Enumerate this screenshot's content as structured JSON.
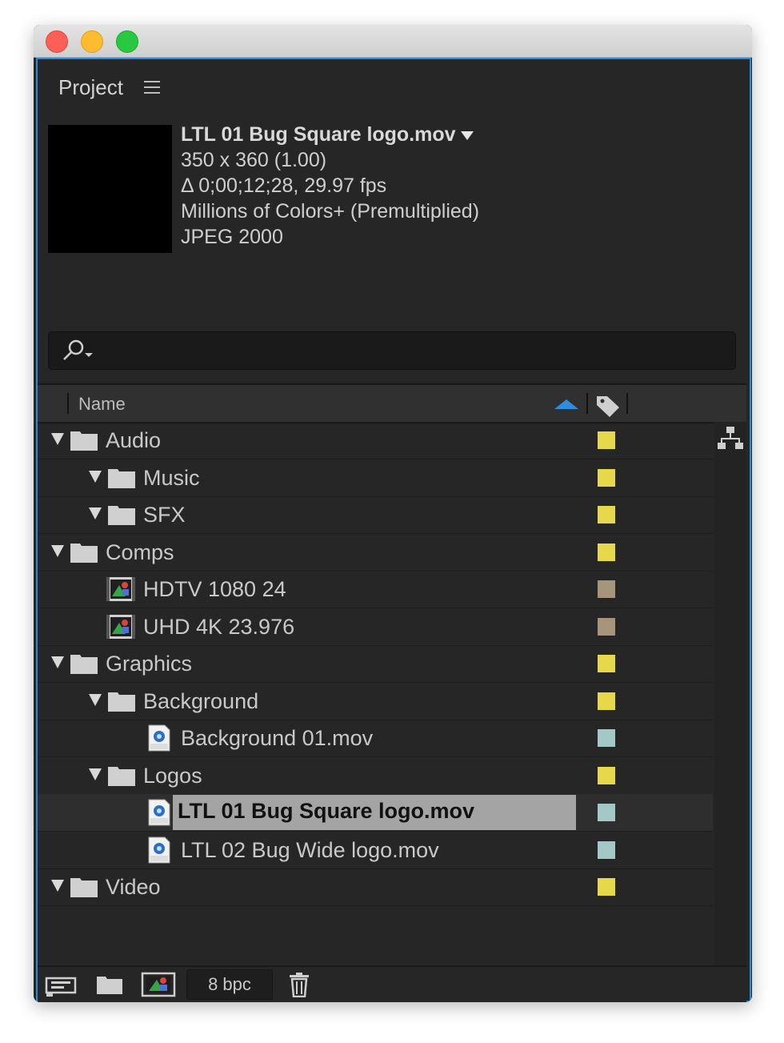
{
  "panel": {
    "title": "Project"
  },
  "preview": {
    "filename": "LTL 01 Bug Square logo.mov",
    "dimensions": "350 x 360 (1.00)",
    "duration": "Δ 0;00;12;28, 29.97 fps",
    "colors": "Millions of Colors+ (Premultiplied)",
    "codec": "JPEG 2000"
  },
  "search": {
    "value": "",
    "placeholder": ""
  },
  "columns": {
    "name": "Name"
  },
  "colors": {
    "folder_label": "#e6d84a",
    "comp_label": "#a6957a",
    "footage_label": "#a4c8c6",
    "accent": "#2b8cde",
    "selection": "#a4a4a4"
  },
  "rows": [
    {
      "label": "Audio",
      "type": "folder",
      "depth": 0,
      "expanded": true,
      "color": "#e6d84a"
    },
    {
      "label": "Music",
      "type": "folder",
      "depth": 1,
      "expanded": true,
      "color": "#e6d84a"
    },
    {
      "label": "SFX",
      "type": "folder",
      "depth": 1,
      "expanded": true,
      "color": "#e6d84a"
    },
    {
      "label": "Comps",
      "type": "folder",
      "depth": 0,
      "expanded": true,
      "color": "#e6d84a"
    },
    {
      "label": "HDTV 1080 24",
      "type": "comp",
      "depth": 1,
      "color": "#a6957a"
    },
    {
      "label": "UHD 4K 23.976",
      "type": "comp",
      "depth": 1,
      "color": "#a6957a"
    },
    {
      "label": "Graphics",
      "type": "folder",
      "depth": 0,
      "expanded": true,
      "color": "#e6d84a"
    },
    {
      "label": "Background",
      "type": "folder",
      "depth": 1,
      "expanded": true,
      "color": "#e6d84a"
    },
    {
      "label": "Background 01.mov",
      "type": "footage",
      "depth": 2,
      "color": "#a4c8c6"
    },
    {
      "label": "Logos",
      "type": "folder",
      "depth": 1,
      "expanded": true,
      "color": "#e6d84a"
    },
    {
      "label": "LTL 01 Bug Square logo.mov",
      "type": "footage",
      "depth": 2,
      "color": "#a4c8c6",
      "selected": true
    },
    {
      "label": "LTL 02 Bug Wide logo.mov",
      "type": "footage",
      "depth": 2,
      "color": "#a4c8c6"
    },
    {
      "label": "Video",
      "type": "folder",
      "depth": 0,
      "expanded": true,
      "color": "#e6d84a"
    }
  ],
  "footer": {
    "bit_depth": "8 bpc"
  },
  "icons": {
    "menu": "hamburger-menu-icon",
    "search": "search-icon",
    "sort": "sort-ascending-icon",
    "label": "tag-icon",
    "flowchart": "flowchart-icon",
    "interpret": "interpret-footage-icon",
    "new_folder": "new-folder-icon",
    "new_comp": "new-composition-icon",
    "delete": "trash-icon"
  }
}
